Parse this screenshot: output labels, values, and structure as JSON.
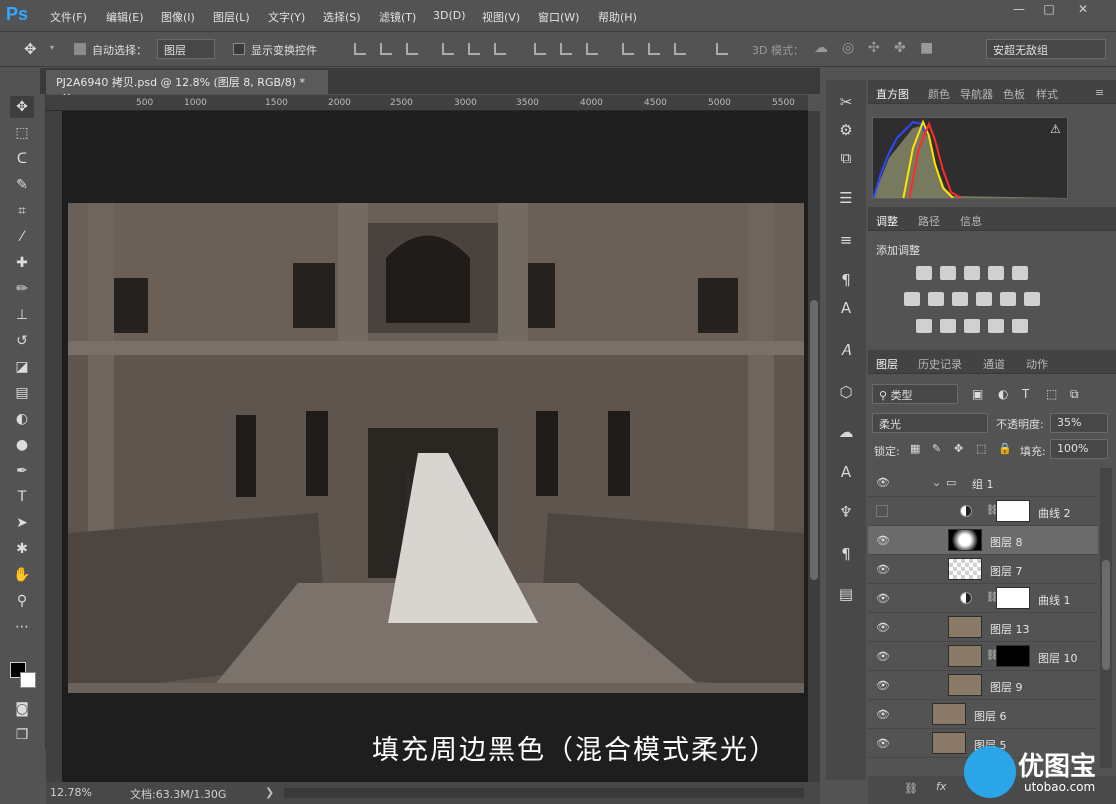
{
  "app": {
    "logo": "Ps"
  },
  "menu": [
    "文件(F)",
    "编辑(E)",
    "图像(I)",
    "图层(L)",
    "文字(Y)",
    "选择(S)",
    "滤镜(T)",
    "3D(D)",
    "视图(V)",
    "窗口(W)",
    "帮助(H)"
  ],
  "window_controls": {
    "min": "—",
    "max": "□",
    "close": "✕"
  },
  "options": {
    "auto_select_label": "自动选择：",
    "auto_select_value": "图层",
    "show_transform_label": "显示变换控件",
    "mode_3d_label": "3D 模式：",
    "workspace": "安超无敌组"
  },
  "document": {
    "tab_title": "PJ2A6940 拷贝.psd @ 12.8% (图层 8, RGB/8) *",
    "close": "×"
  },
  "ruler": {
    "ticks": [
      "500",
      "1000",
      "1500",
      "2000",
      "2500",
      "3000",
      "3500",
      "4000",
      "4500",
      "5000",
      "5500"
    ]
  },
  "canvas": {
    "caption": "填充周边黑色（混合模式柔光）"
  },
  "status": {
    "zoom": "12.78%",
    "doc_info": "文档:63.3M/1.30G",
    "arrow": "❯"
  },
  "histogram_panel": {
    "tabs": [
      "直方图",
      "颜色",
      "导航器",
      "色板",
      "样式"
    ],
    "active": "直方图",
    "warning": "⚠"
  },
  "adjust_panel": {
    "tabs": [
      "调整",
      "路径",
      "信息"
    ],
    "active": "调整",
    "title": "添加调整"
  },
  "layers_panel": {
    "tabs": [
      "图层",
      "历史记录",
      "通道",
      "动作"
    ],
    "active": "图层",
    "filter_label": "类型",
    "blend_mode": "柔光",
    "opacity_label": "不透明度:",
    "opacity_value": "35%",
    "lock_label": "锁定:",
    "fill_label": "填充:",
    "fill_value": "100%",
    "layers": [
      {
        "name": "组 1",
        "visible": true,
        "kind": "group"
      },
      {
        "name": "曲线 2",
        "visible": false,
        "kind": "adjust"
      },
      {
        "name": "图层 8",
        "visible": true,
        "kind": "layer",
        "selected": true
      },
      {
        "name": "图层 7",
        "visible": true,
        "kind": "layer"
      },
      {
        "name": "曲线 1",
        "visible": true,
        "kind": "adjust"
      },
      {
        "name": "图层 13",
        "visible": true,
        "kind": "layer"
      },
      {
        "name": "图层 10",
        "visible": true,
        "kind": "layer-mask"
      },
      {
        "name": "图层 9",
        "visible": true,
        "kind": "layer"
      },
      {
        "name": "图层 6",
        "visible": true,
        "kind": "layer"
      },
      {
        "name": "图层 5",
        "visible": true,
        "kind": "layer"
      }
    ],
    "footer": {
      "link": "⛓",
      "fx": "fx"
    }
  },
  "watermark": {
    "text": "优图宝",
    "url": "utobao.com"
  },
  "colors": {
    "accent": "#31a8ff",
    "panel_bg": "#535353",
    "canvas_bg": "#1e1e1e"
  }
}
